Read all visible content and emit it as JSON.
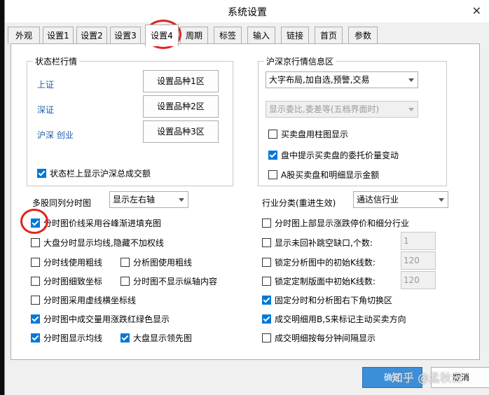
{
  "window": {
    "title": "系统设置"
  },
  "tabs": [
    "外观",
    "设置1",
    "设置2",
    "设置3",
    "设置4",
    "周期",
    "标签",
    "输入",
    "链接",
    "首页",
    "参数"
  ],
  "status_group": {
    "title": "状态栏行情",
    "rows": [
      {
        "label": "上证",
        "button": "设置品种1区"
      },
      {
        "label": "深证",
        "button": "设置品种2区"
      },
      {
        "label": "沪深 创业",
        "button": "设置品种3区"
      }
    ],
    "show_checkbox": {
      "label": "状态栏上显示沪深总成交额",
      "checked": true
    }
  },
  "hs_group": {
    "title": "沪深京行情信息区",
    "select1": "大字布局,加自选,预警,交易",
    "select2": "显示委比,委差等(五档界面时)",
    "checks": [
      {
        "label": "买卖盘用柱图显示",
        "checked": false
      },
      {
        "label": "盘中提示买卖盘的委托价量变动",
        "checked": true
      },
      {
        "label": "A股买卖盘和明细显示金额",
        "checked": false
      }
    ]
  },
  "multi_stock": {
    "label": "多股同列分时图",
    "value": "显示左右轴"
  },
  "industry": {
    "label": "行业分类(重进生效)",
    "value": "通达信行业"
  },
  "left_checks": [
    {
      "label": "分时图价线采用谷峰渐进填充图",
      "checked": true
    },
    {
      "label": "大盘分时显示均线,隐藏不加权线",
      "checked": false
    },
    {
      "label": "分时线使用粗线",
      "checked": false
    },
    {
      "label": "分时图细致坐标",
      "checked": false
    },
    {
      "label": "分时图采用虚线横坐标线",
      "checked": false
    },
    {
      "label": "分时图中成交量用涨跌红绿色显示",
      "checked": true
    },
    {
      "label": "分时图显示均线",
      "checked": true
    }
  ],
  "mid_checks": [
    {
      "label": "分析图使用粗线",
      "checked": false
    },
    {
      "label": "分时图不显示纵轴内容",
      "checked": false
    },
    {
      "label": "大盘显示领先图",
      "checked": true
    }
  ],
  "right_checks": [
    {
      "label": "分时图上部显示涨跌停价和细分行业",
      "checked": false
    },
    {
      "label": "显示未回补跳空缺口,个数:",
      "checked": false,
      "spin": "1"
    },
    {
      "label": "锁定分析图中的初始K线数:",
      "checked": false,
      "spin": "120"
    },
    {
      "label": "锁定定制版面中初始K线数:",
      "checked": false,
      "spin": "120"
    },
    {
      "label": "固定分时和分析图右下角切换区",
      "checked": true
    },
    {
      "label": "成交明细用B,S来标记主动买卖方向",
      "checked": true
    },
    {
      "label": "成交明细按每分钟间隔显示",
      "checked": false
    }
  ],
  "footer": {
    "ok": "确定",
    "cancel": "取消",
    "watermark": "知乎 @孟秋云"
  },
  "colors": {
    "accent": "#0078d7",
    "highlight_circle": "#e0231b",
    "label_blue": "#1a5aa6"
  }
}
